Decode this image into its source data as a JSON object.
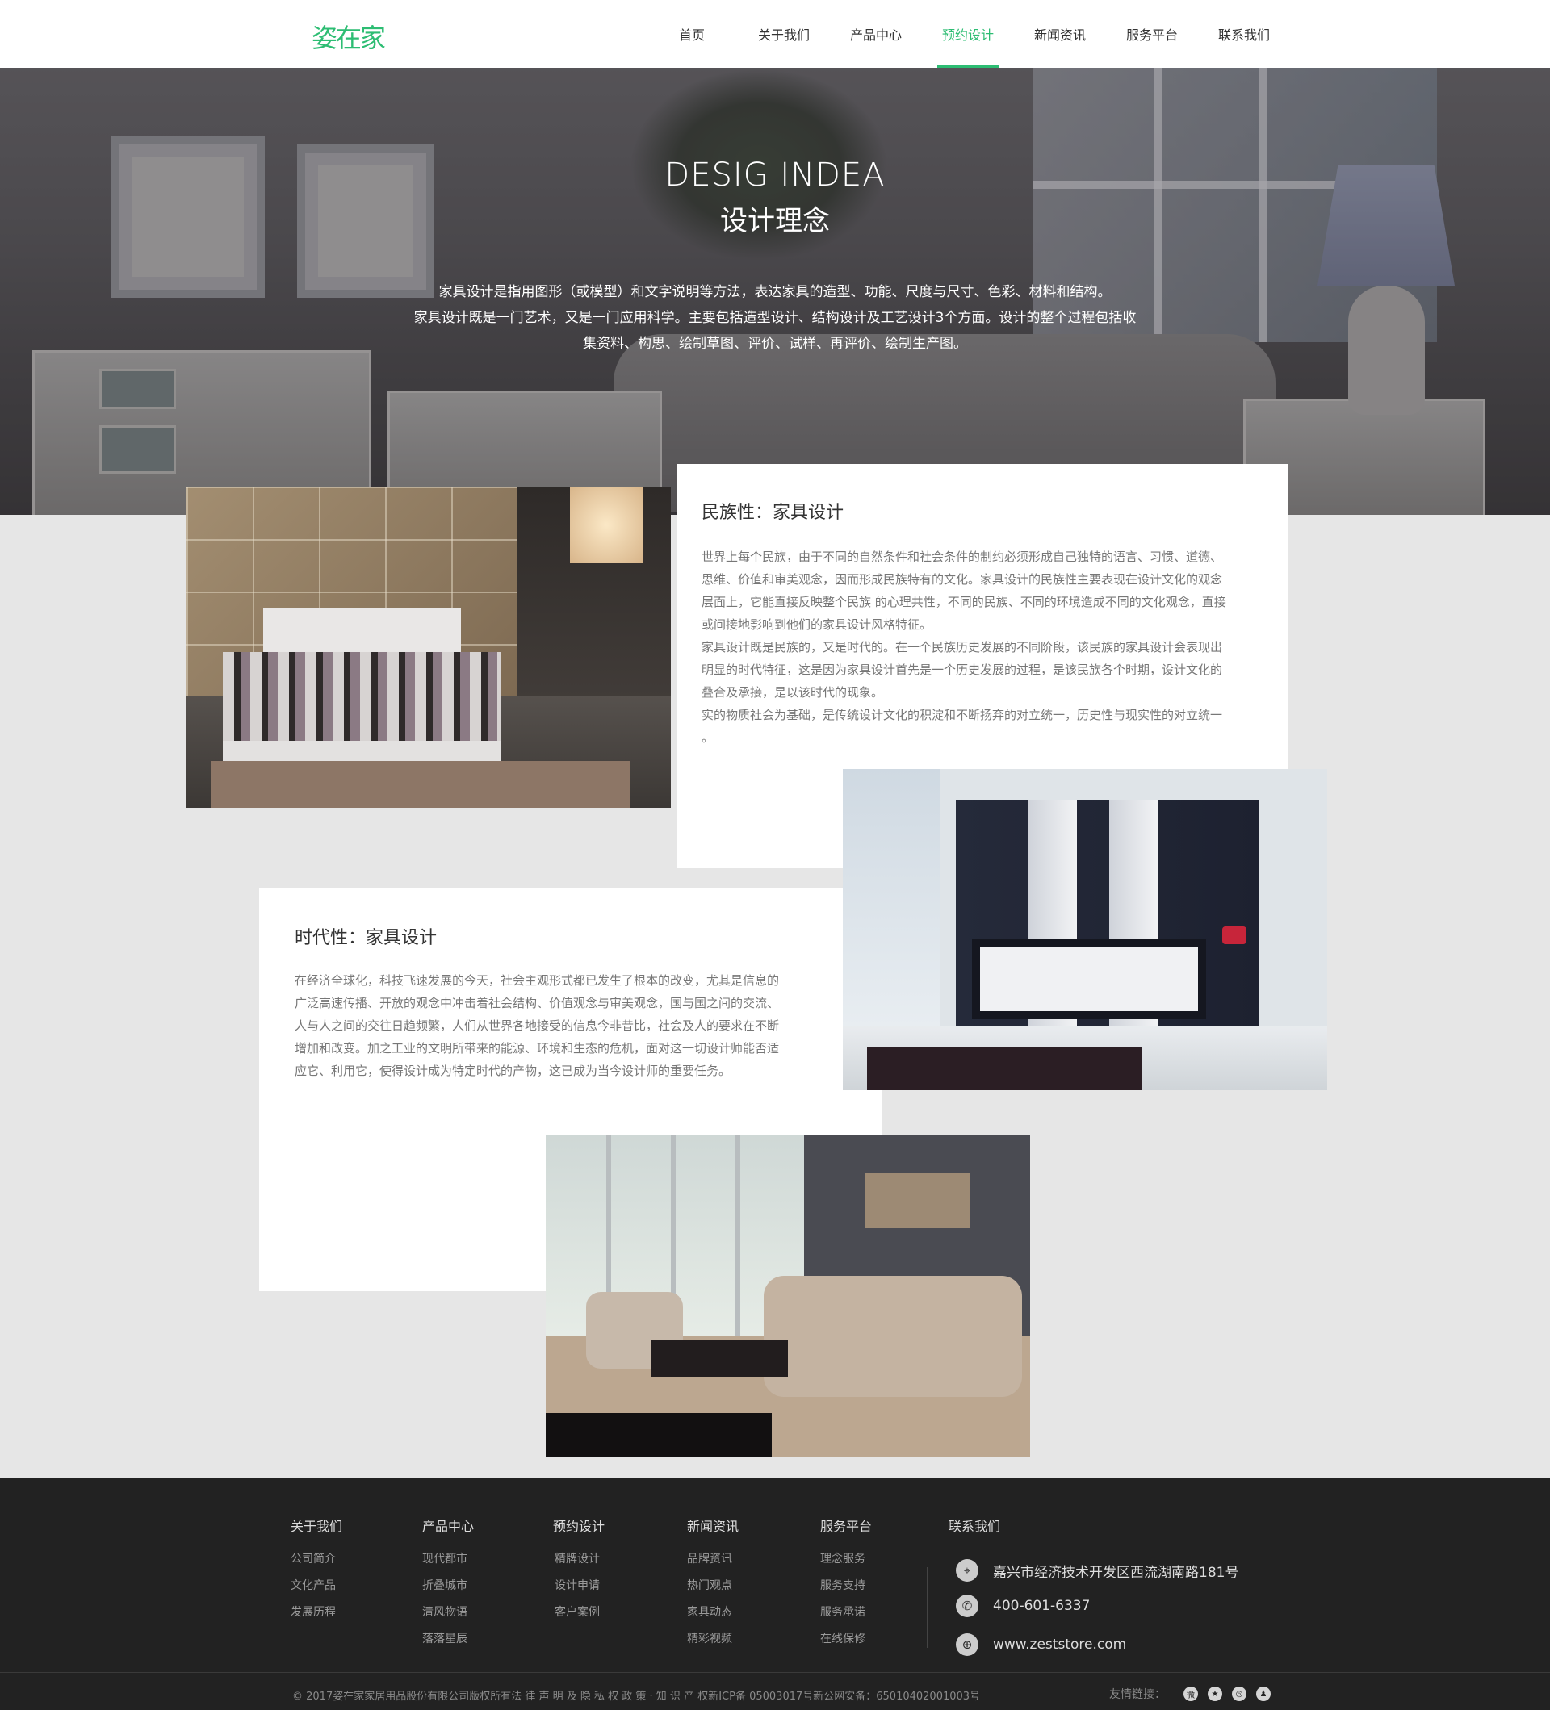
{
  "header": {
    "logo": "姿在家",
    "nav": [
      {
        "label": "首页"
      },
      {
        "label": "关于我们"
      },
      {
        "label": "产品中心"
      },
      {
        "label": "预约设计"
      },
      {
        "label": "新闻资讯"
      },
      {
        "label": "服务平台"
      },
      {
        "label": "联系我们"
      }
    ],
    "active_nav": "预约设计"
  },
  "hero": {
    "title_en": "DESIG INDEA",
    "title_cn": "设计理念",
    "desc_line1": "家具设计是指用图形（或模型）和文字说明等方法，表达家具的造型、功能、尺度与尺寸、色彩、材料和结构。",
    "desc_line2": "家具设计既是一门艺术，又是一门应用科学。主要包括造型设计、结构设计及工艺设计3个方面。设计的整个过程包括收",
    "desc_line3": "集资料、构思、绘制草图、评价、试样、再评价、绘制生产图。"
  },
  "section1": {
    "title": "民族性：家具设计",
    "lines": [
      "世界上每个民族，由于不同的自然条件和社会条件的制约必须形成自己独特的语言、习惯、道德、",
      "思维、价值和审美观念，因而形成民族特有的文化。家具设计的民族性主要表现在设计文化的观念",
      "层面上，它能直接反映整个民族 的心理共性，不同的民族、不同的环境造成不同的文化观念，直接",
      "或间接地影响到他们的家具设计风格特征。",
      "家具设计既是民族的，又是时代的。在一个民族历史发展的不同阶段，该民族的家具设计会表现出",
      "明显的时代特征，这是因为家具设计首先是一个历史发展的过程，是该民族各个时期，设计文化的",
      "叠合及承接，是以该时代的现象。",
      "实的物质社会为基础，是传统设计文化的积淀和不断扬弃的对立统一，历史性与现实性的对立统一",
      "。"
    ]
  },
  "section2": {
    "title": "时代性：家具设计",
    "lines": [
      "在经济全球化，科技飞速发展的今天，社会主观形式都已发生了根本的改变，尤其是信息的",
      "广泛高速传播、开放的观念中冲击着社会结构、价值观念与审美观念，国与国之间的交流、",
      "人与人之间的交往日趋频繁，人们从世界各地接受的信息今非昔比，社会及人的要求在不断",
      "增加和改变。加之工业的文明所带来的能源、环境和生态的危机，面对这一切设计师能否适",
      "应它、利用它，使得设计成为特定时代的产物，这已成为当今设计师的重要任务。"
    ]
  },
  "footer": {
    "columns": [
      {
        "title": "关于我们",
        "links": [
          "公司简介",
          "文化产品",
          "发展历程"
        ]
      },
      {
        "title": "产品中心",
        "links": [
          "现代都市",
          "折叠城市",
          "清风物语",
          "落落星辰"
        ]
      },
      {
        "title": "预约设计",
        "links": [
          "精牌设计",
          "设计申请",
          "客户案例"
        ]
      },
      {
        "title": "新闻资讯",
        "links": [
          "品牌资讯",
          "热门观点",
          "家具动态",
          "精彩视频"
        ]
      },
      {
        "title": "服务平台",
        "links": [
          "理念服务",
          "服务支持",
          "服务承诺",
          "在线保修"
        ]
      }
    ],
    "contact": {
      "title": "联系我们",
      "address": "嘉兴市经济技术开发区西流湖南路181号",
      "phone": "400-601-6337",
      "website": "www.zeststore.com"
    },
    "copyright": "© 2017姿在家家居用品股份有限公司版权所有法 律 声 明 及 隐 私 权 政 策 · 知 识 产 权新ICP备 05003017号新公网安备：65010402001003号",
    "friends_label": "友情链接：",
    "social_icons": [
      "weibo-icon",
      "qzone-icon",
      "wechat-icon",
      "qq-icon"
    ]
  },
  "colors": {
    "accent": "#2dbd73",
    "footer_bg": "#222222",
    "page_bg": "#e6e6e6"
  }
}
